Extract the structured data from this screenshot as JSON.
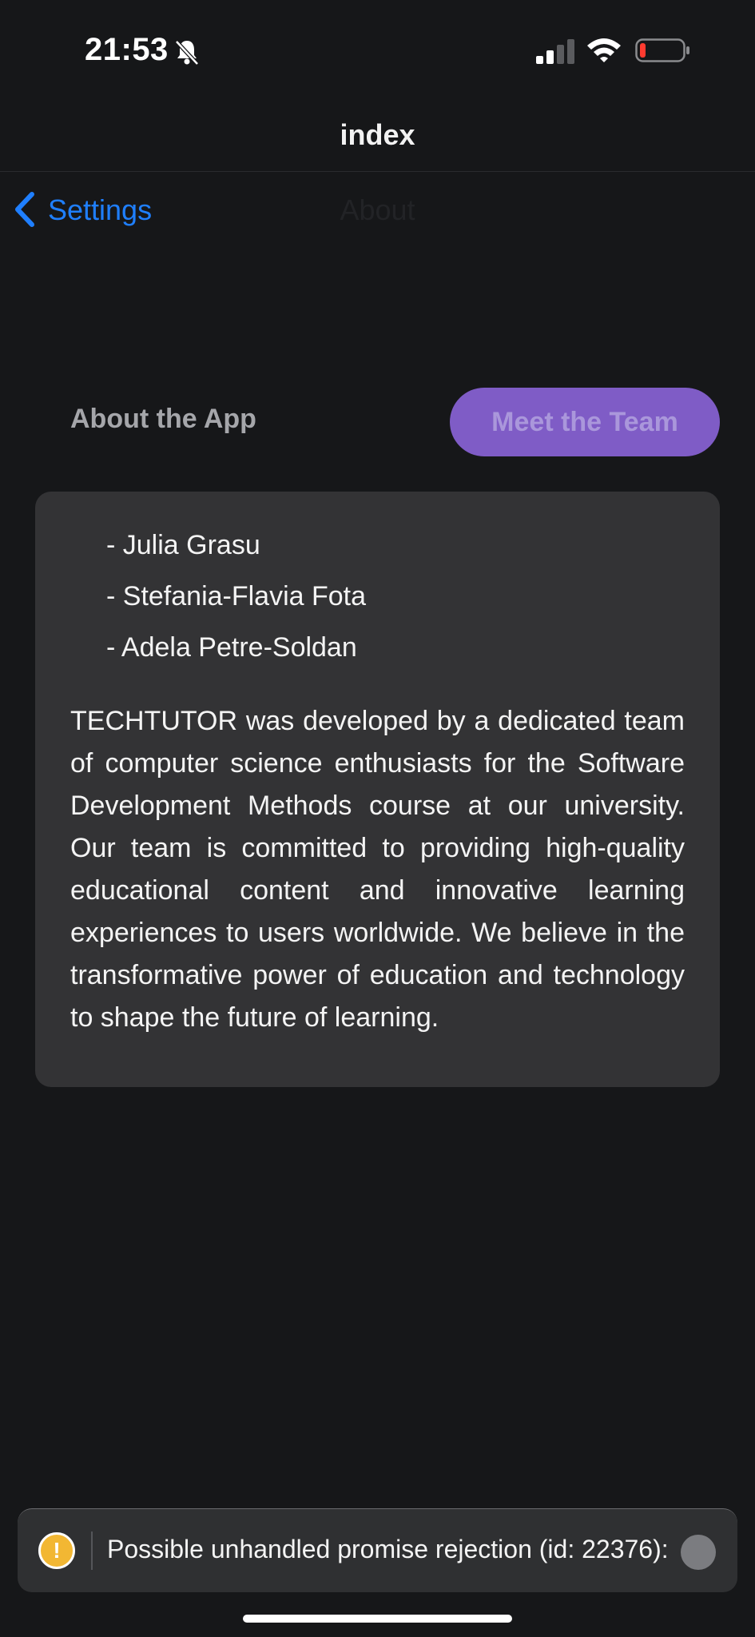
{
  "status_bar": {
    "time": "21:53",
    "icons": [
      "bell-slash-icon",
      "signal-icon",
      "wifi-icon",
      "battery-low-icon"
    ]
  },
  "nav": {
    "title": "index",
    "back_label": "Settings",
    "faded_title": "About"
  },
  "tabs": {
    "about_label": "About the App",
    "team_label": "Meet the Team"
  },
  "team": {
    "members": [
      "- Julia Grasu",
      "- Stefania-Flavia Fota",
      "- Adela Petre-Soldan"
    ],
    "description": "TECHTUTOR was developed by a dedicated team of computer science enthusiasts for the Software Development Methods course at our university. Our team is committed to providing high-quality educational content and innovative learning experiences to users worldwide. We believe in the transformative power of education and technology to shape the future of learning."
  },
  "toast": {
    "icon": "warning-icon",
    "message": "Possible unhandled promise rejection (id: 22376):"
  },
  "colors": {
    "background": "#161719",
    "accent_blue": "#1f7fff",
    "tab_purple": "#7f5cc6",
    "card": "#333335",
    "warning": "#f2b733",
    "battery_red": "#ff3b30"
  }
}
